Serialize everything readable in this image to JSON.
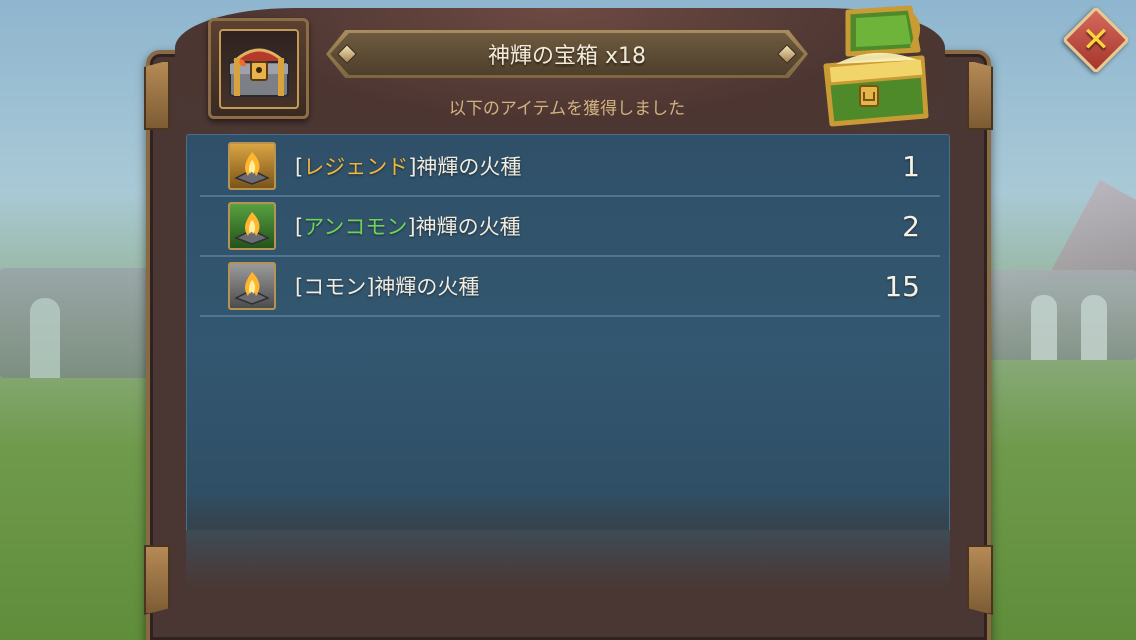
{
  "header": {
    "title": "神輝の宝箱 x18",
    "subtitle": "以下のアイテムを獲得しました"
  },
  "close_icon": "close-icon",
  "items": [
    {
      "rarity_open": "[",
      "rarity": "レジェンド",
      "rarity_close": "]",
      "name": "神輝の火種",
      "qty": "1",
      "rarity_color": "#f0b53a"
    },
    {
      "rarity_open": "[",
      "rarity": "アンコモン",
      "rarity_close": "]",
      "name": "神輝の火種",
      "qty": "2",
      "rarity_color": "#6fd35a"
    },
    {
      "rarity_open": "[",
      "rarity": "コモン",
      "rarity_close": "]",
      "name": "神輝の火種",
      "qty": "15",
      "rarity_color": "#f1ecdf"
    }
  ]
}
